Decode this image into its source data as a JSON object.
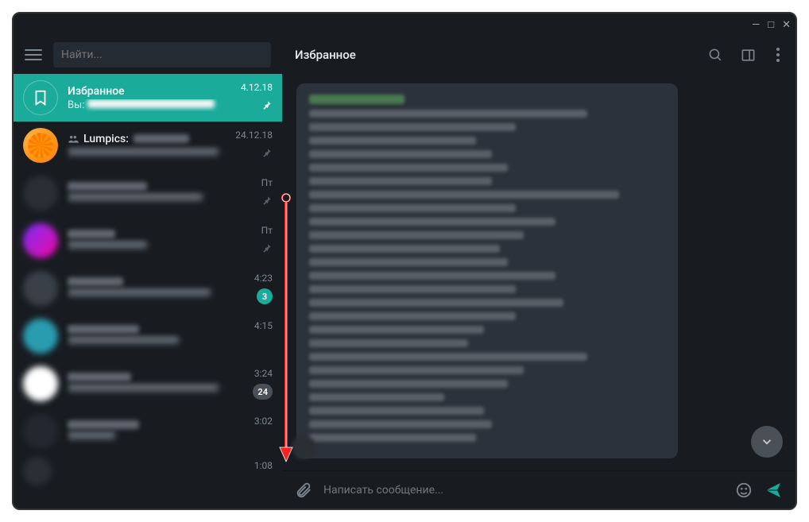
{
  "search": {
    "placeholder": "Найти..."
  },
  "chat_header": {
    "title": "Избранное"
  },
  "sidebar": {
    "items": [
      {
        "name": "Избранное",
        "preview_prefix": "Вы:",
        "date": "4.12.18",
        "pinned": true,
        "active": true
      },
      {
        "name": "Lumpics:",
        "date": "24.12.18",
        "pinned": true,
        "group": true
      },
      {
        "date": "Пт",
        "pinned": true
      },
      {
        "date": "Пт",
        "pinned": true
      },
      {
        "date": "4:23",
        "badge": "3",
        "badge_style": "green"
      },
      {
        "date": "4:15"
      },
      {
        "date": "3:24",
        "badge": "24",
        "badge_style": "gray"
      },
      {
        "date": "3:02"
      },
      {
        "date": "1:08"
      }
    ]
  },
  "composer": {
    "placeholder": "Написать сообщение..."
  },
  "window_controls": {
    "min": "—",
    "max": "□",
    "close": "✕"
  }
}
